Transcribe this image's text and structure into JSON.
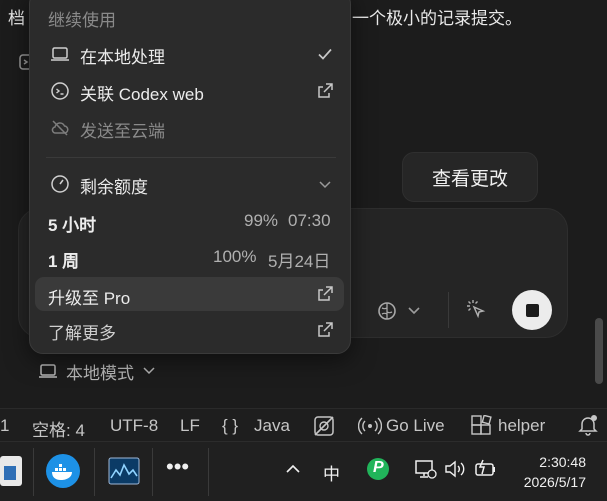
{
  "background": {
    "top_text_left": "档",
    "top_text_right": "一个极小的记录提交。",
    "review_button": "查看更改",
    "local_mode": "本地模式"
  },
  "menu": {
    "section_title": "继续使用",
    "items": [
      {
        "label": "在本地处理",
        "icon": "laptop-icon",
        "right": "check-icon"
      },
      {
        "label": "关联 Codex web",
        "icon": "codex-terminal-icon",
        "right": "external-link-icon"
      },
      {
        "label": "发送至云端",
        "icon": "cloud-off-icon",
        "disabled": true
      }
    ],
    "quota": {
      "label": "剩余额度",
      "icon": "gauge-icon",
      "rows": [
        {
          "label": "5 小时",
          "percent": "99%",
          "reset": "07:30"
        },
        {
          "label": "1 周",
          "percent": "100%",
          "reset": "5月24日"
        }
      ]
    },
    "upgrade": "升级至 Pro",
    "learn_more": "了解更多"
  },
  "statusbar": {
    "line": "1",
    "spaces": "空格: 4",
    "encoding": "UTF-8",
    "eol": "LF",
    "language_braces": "{ }",
    "language": "Java",
    "go_live": "Go Live",
    "helper": "helper"
  },
  "taskbar": {
    "ime": "中",
    "time": "2:30:48",
    "date": "2026/5/17"
  },
  "colors": {
    "menu_bg": "#2b2b2b",
    "page_bg": "#1c1c1c",
    "docker_blue": "#1d91e6",
    "tray_green": "#21b45a"
  }
}
